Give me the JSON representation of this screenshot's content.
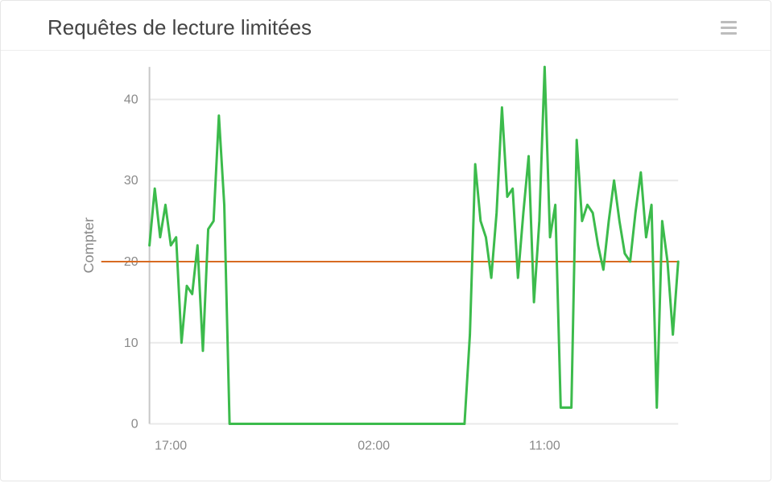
{
  "header": {
    "title": "Requêtes de lecture limitées"
  },
  "menu_icon": "hamburger-icon",
  "chart_data": {
    "type": "line",
    "title": "Requêtes de lecture limitées",
    "ylabel": "Compter",
    "xlabel": "",
    "ylim": [
      0,
      44
    ],
    "yticks": [
      0,
      10,
      20,
      30,
      40
    ],
    "xlabels": [
      "17:00",
      "02:00",
      "11:00"
    ],
    "threshold": 20,
    "x": [
      0,
      1,
      2,
      3,
      4,
      5,
      6,
      7,
      8,
      9,
      10,
      11,
      12,
      13,
      14,
      15,
      16,
      17,
      18,
      19,
      20,
      21,
      22,
      23,
      24,
      25,
      26,
      27,
      28,
      29,
      30,
      31,
      32,
      33,
      34,
      35,
      36,
      37,
      38,
      39,
      40,
      41,
      42,
      43,
      44,
      45,
      46,
      47,
      48,
      49,
      50,
      51,
      52,
      53,
      54,
      55,
      56,
      57,
      58,
      59,
      60,
      61,
      62,
      63,
      64,
      65,
      66,
      67,
      68,
      69,
      70,
      71,
      72,
      73,
      74,
      75,
      76,
      77,
      78,
      79,
      80,
      81,
      82,
      83,
      84,
      85,
      86,
      87,
      88,
      89,
      90,
      91,
      92,
      93,
      94,
      95,
      96,
      97,
      98,
      99
    ],
    "values": [
      22,
      29,
      23,
      27,
      22,
      23,
      10,
      17,
      16,
      22,
      9,
      24,
      25,
      38,
      27,
      0,
      0,
      0,
      0,
      0,
      0,
      0,
      0,
      0,
      0,
      0,
      0,
      0,
      0,
      0,
      0,
      0,
      0,
      0,
      0,
      0,
      0,
      0,
      0,
      0,
      0,
      0,
      0,
      0,
      0,
      0,
      0,
      0,
      0,
      0,
      0,
      0,
      0,
      0,
      0,
      0,
      0,
      0,
      0,
      0,
      11,
      32,
      25,
      23,
      18,
      26,
      39,
      28,
      29,
      18,
      26,
      33,
      15,
      25,
      44,
      23,
      27,
      2,
      2,
      2,
      35,
      25,
      27,
      26,
      22,
      19,
      25,
      30,
      25,
      21,
      20,
      26,
      31,
      23,
      27,
      2,
      25,
      20,
      11,
      20
    ]
  }
}
